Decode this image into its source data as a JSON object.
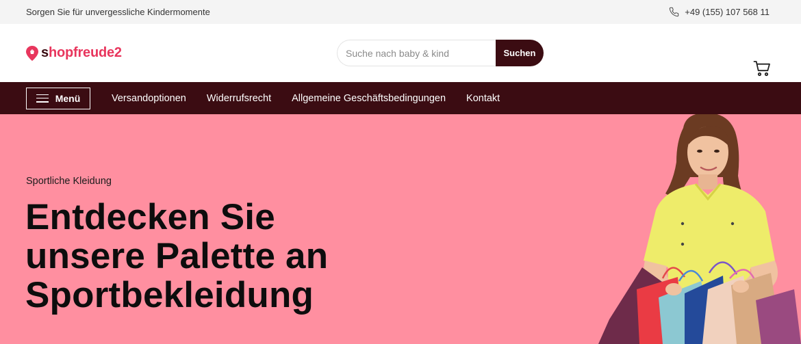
{
  "topbar": {
    "tagline": "Sorgen Sie für unvergessliche Kindermomente",
    "phone": "+49 (155) 107 568 11",
    "phone_icon": "phone-icon"
  },
  "header": {
    "logo_s": "s",
    "logo_rest": "hopfreude2",
    "logo_icon": "location-pin-icon",
    "search_placeholder": "Suche nach baby & kind",
    "search_value": "",
    "search_button": "Suchen",
    "cart_icon": "cart-icon"
  },
  "nav": {
    "menu_label": "Menü",
    "menu_icon": "hamburger-icon",
    "links": [
      "Versandoptionen",
      "Widerrufsrecht",
      "Allgemeine Geschäftsbedingungen",
      "Kontakt"
    ]
  },
  "hero": {
    "subtitle": "Sportliche Kleidung",
    "title_lines": [
      "Entdecken Sie",
      "unsere Palette an",
      "Sportbekleidung"
    ]
  },
  "colors": {
    "brand": "#e8365d",
    "dark": "#3b0c12",
    "hero_bg": "#ff8fa0"
  }
}
